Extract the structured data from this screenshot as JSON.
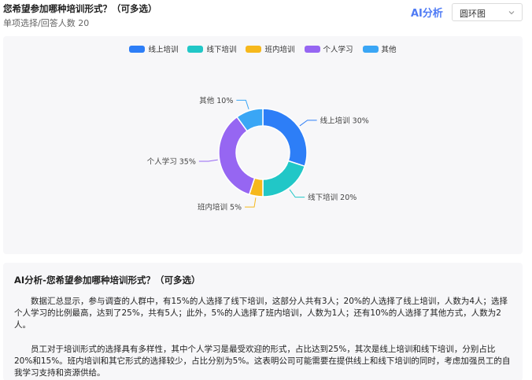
{
  "question": {
    "title": "您希望参加哪种培训形式？（可多选）",
    "subtitle": "单项选择/回答人数 20"
  },
  "toolbar": {
    "ai_label": "AI分析",
    "chart_type_selected": "圆环图"
  },
  "chart_data": {
    "type": "pie",
    "donut": true,
    "categories": [
      "线上培训",
      "线下培训",
      "班内培训",
      "个人学习",
      "其他"
    ],
    "values": [
      30,
      20,
      5,
      35,
      10
    ],
    "unit": "%",
    "colors": [
      "#2d7ef7",
      "#21c7c7",
      "#f6b81c",
      "#9666f2",
      "#3aa6f5"
    ],
    "data_labels": [
      "线上培训 30%",
      "线下培训 20%",
      "班内培训 5%",
      "个人学习 35%",
      "其他 10%"
    ],
    "legend_position": "top-center"
  },
  "analysis": {
    "heading": "AI分析-您希望参加哪种培训形式？（可多选）",
    "paragraphs": [
      "数据汇总显示，参与调查的人群中，有15%的人选择了线下培训，这部分人共有3人；20%的人选择了线上培训，人数为4人；选择个人学习的比例最高，达到了25%，共有5人；此外，5%的人选择了班内培训，人数为1人；还有10%的人选择了其他方式，人数为2人。",
      "员工对于培训形式的选择具有多样性，其中个人学习是最受欢迎的形式，占比达到25%，其次是线上培训和线下培训，分别占比20%和15%。班内培训和其它形式的选择较少，占比分别为5%。这表明公司可能需要在提供线上和线下培训的同时，考虑加强员工的自我学习支持和资源供给。"
    ]
  }
}
